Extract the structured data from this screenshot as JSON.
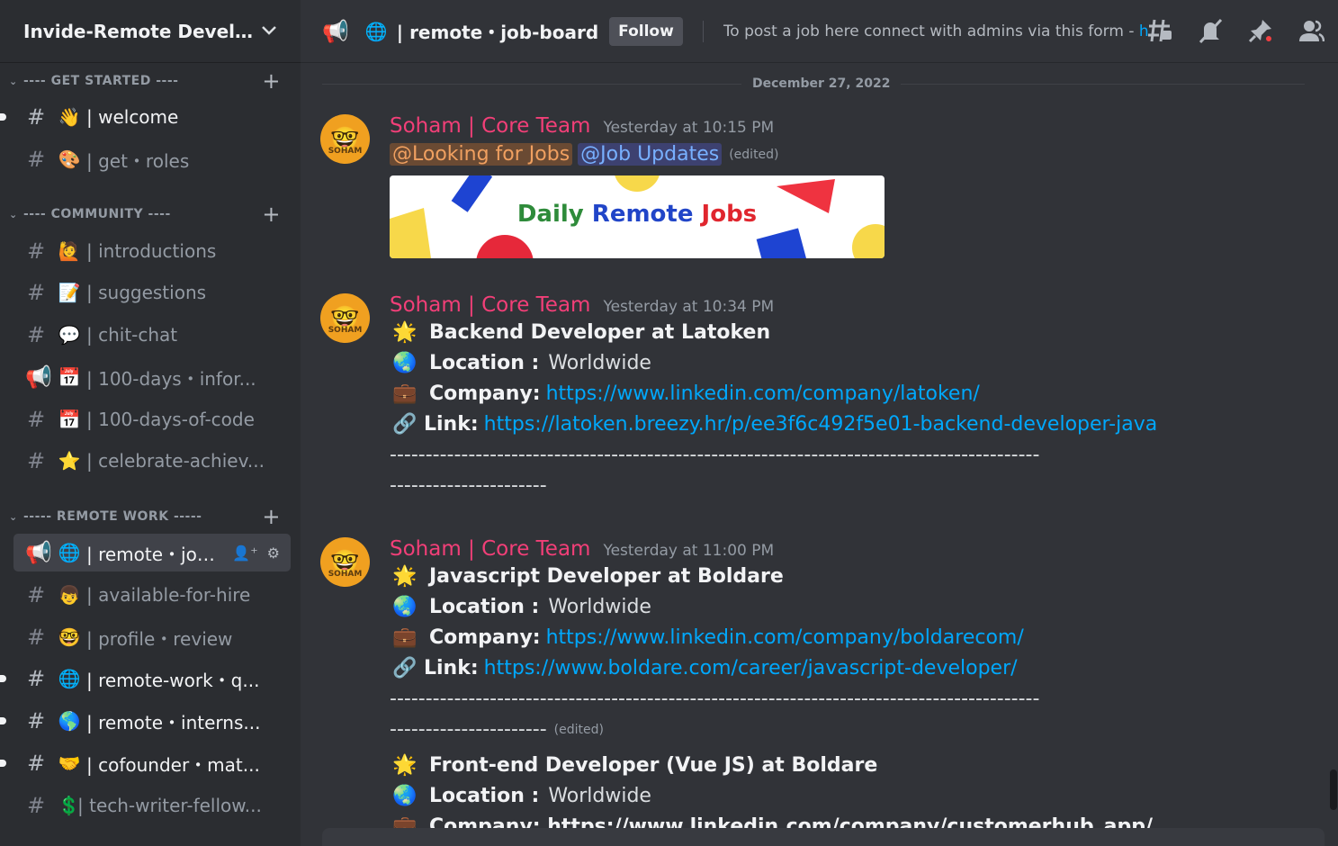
{
  "server": {
    "name": "Invide-Remote Develope...",
    "chevron_icon": "chevron-down-icon"
  },
  "categories": [
    {
      "label": "---- GET STARTED ----"
    },
    {
      "label": "---- COMMUNITY ----"
    },
    {
      "label": "----- REMOTE WORK -----"
    }
  ],
  "channels": [
    {
      "emoji": "👋",
      "label": "| welcome",
      "icon": "hash-icon"
    },
    {
      "emoji": "🎨",
      "label": "| get・roles",
      "icon": "hash-icon"
    },
    {
      "emoji": "🙋",
      "label": "| introductions",
      "icon": "hash-icon"
    },
    {
      "emoji": "📝",
      "label": "| suggestions",
      "icon": "hash-threads-icon"
    },
    {
      "emoji": "💬",
      "label": "| chit-chat",
      "icon": "hash-icon"
    },
    {
      "emoji": "📅",
      "label": "| 100-days・infor...",
      "icon": "announcement-icon"
    },
    {
      "emoji": "📅",
      "label": "| 100-days-of-code",
      "icon": "hash-icon"
    },
    {
      "emoji": "⭐",
      "label": "| celebrate-achiev...",
      "icon": "hash-icon"
    },
    {
      "emoji": "🌐",
      "label": "| remote・job...",
      "icon": "announcement-icon"
    },
    {
      "emoji": "👦",
      "label": "| available-for-hire",
      "icon": "hash-threads-icon"
    },
    {
      "emoji": "🤓",
      "label": "| profile・review",
      "icon": "hash-icon"
    },
    {
      "emoji": "🌐",
      "label": "| remote-work・q...",
      "icon": "hash-threads-icon"
    },
    {
      "emoji": "🌎",
      "label": "| remote・interns...",
      "icon": "hash-icon"
    },
    {
      "emoji": "🤝",
      "label": "| cofounder・mat...",
      "icon": "hash-icon"
    },
    {
      "emoji": "💲",
      "label": "| tech-writer-fellow...",
      "icon": "hash-icon"
    }
  ],
  "topbar": {
    "globe": "🌐",
    "title": "| remote・job-board",
    "follow_label": "Follow",
    "topic_text": "To post a job here connect with admins via this form - ",
    "topic_link": "http..."
  },
  "date_divider": "December 27, 2022",
  "messages": [
    {
      "author": "Soham | Core Team",
      "timestamp": "Yesterday at 10:15 PM",
      "mention1": "@Looking for Jobs",
      "mention2": "@Job Updates",
      "edited": "(edited)",
      "banner": {
        "word1": "Daily",
        "word2": "Remote",
        "word3": "Jobs"
      }
    },
    {
      "author": "Soham | Core Team",
      "timestamp": "Yesterday at 10:34 PM",
      "title": "Backend Developer at Latoken",
      "location_label": "Location :",
      "location_value": "Worldwide",
      "company_label": "Company:",
      "company_link": "https://www.linkedin.com/company/latoken/",
      "link_label": "Link:",
      "link_url": "https://latoken.breezy.hr/p/ee3f6c492f5e01-backend-developer-java",
      "dashes1": "-------------------------------------------------------------------------------------------",
      "dashes2": "----------------------"
    },
    {
      "author": "Soham | Core Team",
      "timestamp": "Yesterday at 11:00 PM",
      "title": "Javascript Developer at Boldare",
      "location_label": "Location :",
      "location_value": "Worldwide",
      "company_label": "Company:",
      "company_link": "https://www.linkedin.com/company/boldarecom/",
      "link_label": "Link:",
      "link_url": "https://www.boldare.com/career/javascript-developer/",
      "dashes1": "-------------------------------------------------------------------------------------------",
      "dashes2": "----------------------",
      "edited": "(edited)",
      "title2": "Front-end Developer (Vue JS) at Boldare",
      "location_label2": "Location :",
      "location_value2": "Worldwide",
      "company_partial": "Company: https://www.linkedin.com/company/customerhub_app/"
    }
  ],
  "emojis": {
    "star": "🌟",
    "globe": "🌏",
    "briefcase": "💼",
    "link": "🔗"
  },
  "colors": {
    "author": "#f23f78",
    "link": "#00a8fc",
    "sidebar": "#2b2d31",
    "chat": "#313338"
  }
}
